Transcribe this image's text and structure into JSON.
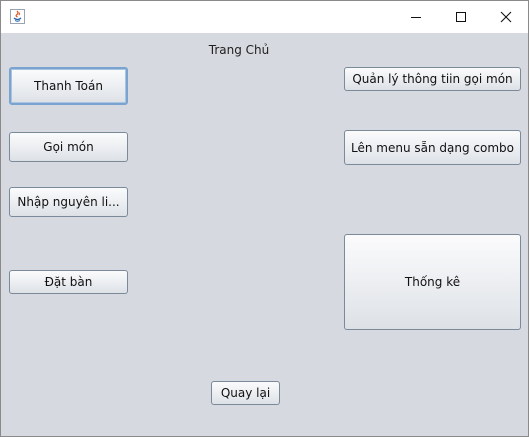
{
  "window": {
    "close_symbol": "✕"
  },
  "main": {
    "title": "Trang Chủ",
    "buttons": {
      "thanh_toan": "Thanh Toán",
      "goi_mon": "Gọi món",
      "nhap_nguyen_lieu": "Nhập nguyên li...",
      "dat_ban": "Đặt bàn",
      "quan_ly": "Quản lý thông tiin gọi món",
      "len_menu": "Lên menu sẵn dạng combo",
      "thong_ke": "Thống kê",
      "quay_lai": "Quay lại"
    }
  },
  "colors": {
    "window_bg": "#d6d9df",
    "titlebar_bg": "#ffffff",
    "button_border": "#7a8a99",
    "focus_border": "#7aa3cf"
  }
}
